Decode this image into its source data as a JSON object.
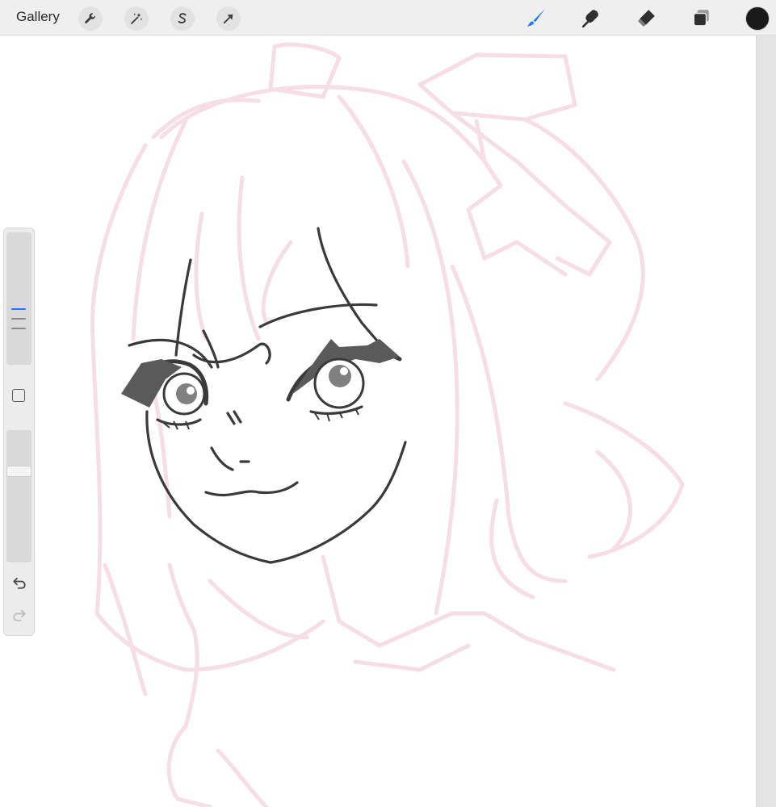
{
  "toolbar": {
    "gallery_label": "Gallery",
    "left_tools": [
      {
        "icon": "wrench-icon",
        "name": "actions"
      },
      {
        "icon": "magic-wand-icon",
        "name": "adjustments"
      },
      {
        "icon": "selection-s-icon",
        "name": "selection"
      },
      {
        "icon": "arrow-cursor-icon",
        "name": "transform"
      }
    ],
    "right_tools": [
      {
        "icon": "brush-icon",
        "name": "paint",
        "active": true
      },
      {
        "icon": "smudge-icon",
        "name": "smudge",
        "active": false
      },
      {
        "icon": "eraser-icon",
        "name": "erase",
        "active": false
      },
      {
        "icon": "layers-icon",
        "name": "layers",
        "active": false
      }
    ],
    "current_color": "#1a1a1a"
  },
  "colors": {
    "accent": "#1e7cf2",
    "sketch_pink": "#f6dde6",
    "ink": "#3a3a3a"
  },
  "sidebar": {
    "brush_size_icon": "size-marks",
    "opacity_icon": "opacity-thumb",
    "undo_icon": "undo-icon",
    "redo_icon": "redo-icon"
  }
}
